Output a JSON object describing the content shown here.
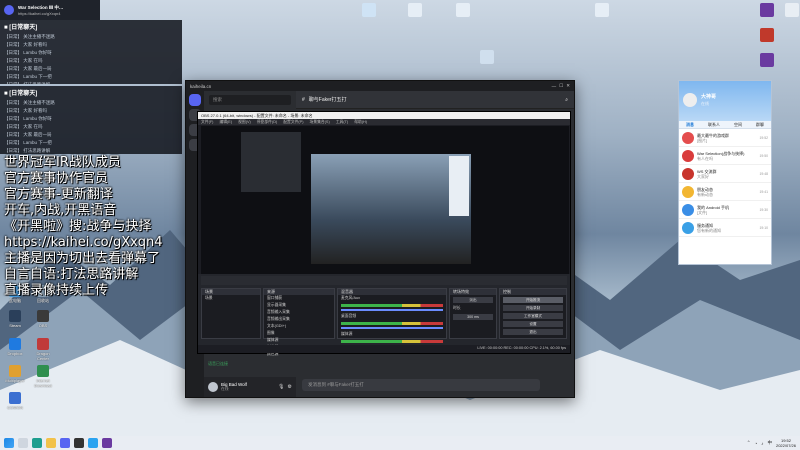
{
  "notification": {
    "title": "War Selection Ⅲ 中…",
    "sub": "https://kaihei.co/gXxqn4"
  },
  "chat_windows": [
    {
      "header": "■ [日常聊天]",
      "lines": [
        "【日常】 关注主播不迷路",
        "【日常】 大家 好看吗",
        "【日常】 Lambu 你好呀",
        "【日常】 大家 在吗",
        "【日常】 大家 最后一局",
        "【日常】 Lambu 下一把",
        "【日常】 打法思路讲解",
        "【日常】 谢谢大家"
      ]
    },
    {
      "header": "■ [日常聊天]",
      "lines": [
        "【日常】 关注主播不迷路",
        "【日常】 大家 好看吗",
        "【日常】 Lambu 你好呀",
        "【日常】 大家 在吗",
        "【日常】 大家 最后一局",
        "【日常】 Lambu 下一把",
        "【日常】 打法思路讲解",
        "【日常】 谢谢大家"
      ]
    }
  ],
  "overlay": {
    "lines": [
      "世界冠军IR战队成员",
      "官方赛事协作官员",
      "官方赛事-更新翻译",
      "开车,内战,开黑语音",
      "《开黑啦》搜:战争与抉择",
      "https://kaihei.co/gXxqn4",
      "主播是因为切出去看弹幕了",
      "自言自语:打法思路讲解",
      "直播录像持续上传"
    ]
  },
  "desktop_icons": [
    {
      "label": "此电脑",
      "color": "#4aa3e8"
    },
    {
      "label": "回收站",
      "color": "#8fa6bb"
    },
    {
      "label": "Steam",
      "color": "#2a3f5a"
    },
    {
      "label": "OBS",
      "color": "#3a3a3a"
    },
    {
      "label": "Dropbox",
      "color": "#1f7ae0"
    },
    {
      "label": "Dragon Center",
      "color": "#c03a3a"
    },
    {
      "label": "Multiplayer",
      "color": "#e0a030"
    },
    {
      "label": "Internet Download",
      "color": "#2f8f4f"
    },
    {
      "label": "COWON",
      "color": "#3b6fd1"
    }
  ],
  "discord": {
    "title": "kaiheila.cn",
    "search_placeholder": "搜索",
    "channel": "聊与Faker打五打",
    "user_name": "Big Bad Wolf",
    "user_status": "在线",
    "message_placeholder": "发消息到 #聊与Faker打五打",
    "voice_label": "语音已连接"
  },
  "obs": {
    "title": "OBS 27.0.1 (64-bit, windows) - 配置文件: 未命名 - 场景: 未命名",
    "menu": [
      "文件(F)",
      "编辑(E)",
      "视图(V)",
      "停靠部件(D)",
      "配置文件(P)",
      "场景集合(S)",
      "工具(T)",
      "帮助(H)"
    ],
    "docks": {
      "scenes": "场景",
      "sources": "来源",
      "mixer": "混音器",
      "transitions": "转场特效",
      "controls": "控制"
    },
    "scenes": [
      "场景"
    ],
    "sources": [
      "窗口捕获",
      "显示器采集",
      "音频输入采集",
      "音频输出采集",
      "文本(GDI+)",
      "图像",
      "媒体源",
      "浏览器",
      "颜色源"
    ],
    "mixer": [
      "麦克风/Aux",
      "桌面音频",
      "媒体源"
    ],
    "transition_value": "淡出",
    "duration_label": "时长",
    "duration_value": "300 ms",
    "controls": [
      "开始推流",
      "开始录制",
      "工作室模式",
      "设置",
      "退出"
    ],
    "status": "LIVE: 00:00:00   REC: 00:00:00   CPU: 2.1%, 60.00 fps"
  },
  "qq": {
    "name": "大神哥",
    "status": "在线",
    "tabs": [
      "消息",
      "联系人",
      "空间",
      "群聊"
    ],
    "items": [
      {
        "name": "最大最牛的游戏群",
        "msg": "[图片]",
        "time": "19:52",
        "color": "#e44d4d"
      },
      {
        "name": "War Selection(战争与抉择)",
        "msg": "有人在吗",
        "time": "19:50",
        "color": "#d93c3c"
      },
      {
        "name": "WS 交流群",
        "msg": "大家好",
        "time": "19:48",
        "color": "#c8342c"
      },
      {
        "name": "朋友动态",
        "msg": "有新动态",
        "time": "19:41",
        "color": "#f2b632"
      },
      {
        "name": "我的 Android 手机",
        "msg": "[文件]",
        "time": "19:30",
        "color": "#3a8ee6"
      },
      {
        "name": "服务通知",
        "msg": "您有新的通知",
        "time": "19:10",
        "color": "#3aa0e6"
      }
    ]
  },
  "taskbar": {
    "time": "19:52",
    "date": "2022/07/26",
    "lang": "中"
  }
}
